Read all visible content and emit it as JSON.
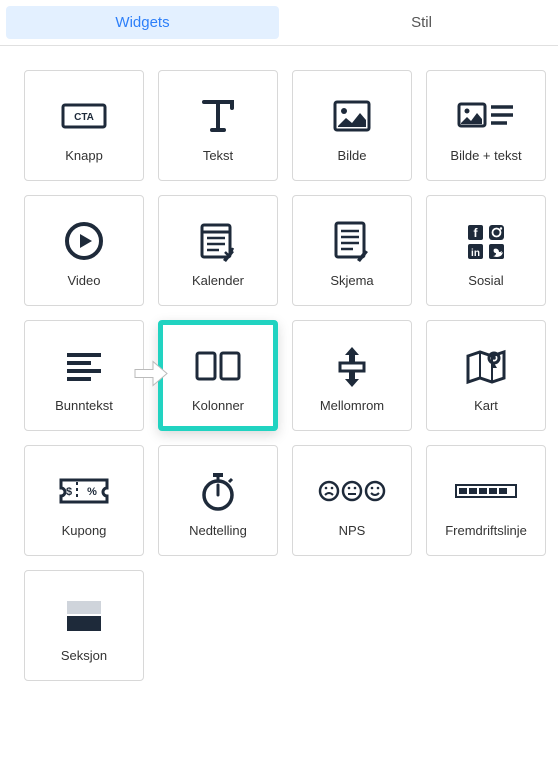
{
  "tabs": {
    "widgets": "Widgets",
    "stil": "Stil"
  },
  "widgets": [
    {
      "id": "knapp",
      "label": "Knapp"
    },
    {
      "id": "tekst",
      "label": "Tekst"
    },
    {
      "id": "bilde",
      "label": "Bilde"
    },
    {
      "id": "bilde-tekst",
      "label": "Bilde + tekst"
    },
    {
      "id": "video",
      "label": "Video"
    },
    {
      "id": "kalender",
      "label": "Kalender"
    },
    {
      "id": "skjema",
      "label": "Skjema"
    },
    {
      "id": "sosial",
      "label": "Sosial"
    },
    {
      "id": "bunntekst",
      "label": "Bunntekst"
    },
    {
      "id": "kolonner",
      "label": "Kolonner"
    },
    {
      "id": "mellomrom",
      "label": "Mellomrom"
    },
    {
      "id": "kart",
      "label": "Kart"
    },
    {
      "id": "kupong",
      "label": "Kupong"
    },
    {
      "id": "nedtelling",
      "label": "Nedtelling"
    },
    {
      "id": "nps",
      "label": "NPS"
    },
    {
      "id": "fremdriftslinje",
      "label": "Fremdriftslinje"
    },
    {
      "id": "seksjon",
      "label": "Seksjon"
    }
  ],
  "highlighted": "kolonner"
}
